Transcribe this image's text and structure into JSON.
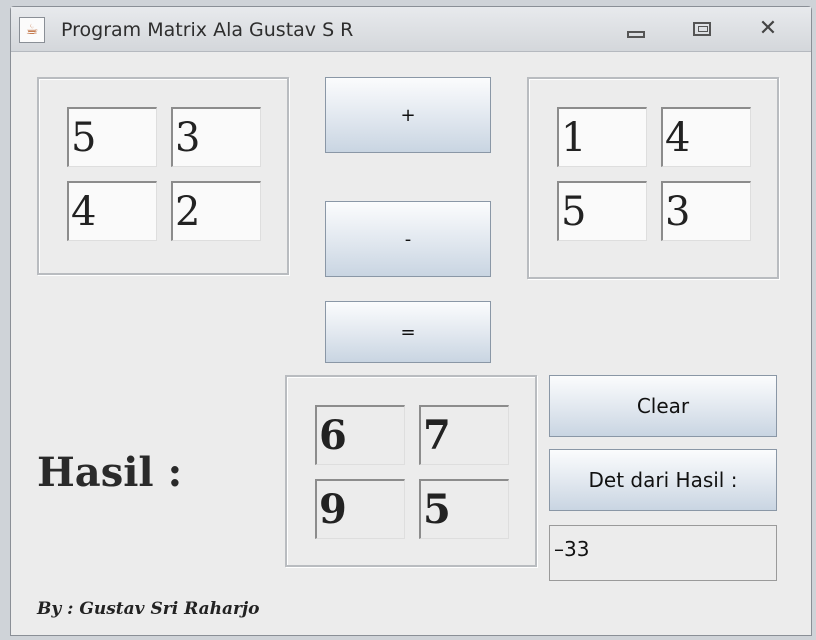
{
  "window": {
    "title": "Program Matrix Ala Gustav S R",
    "app_icon": "java-cup-icon",
    "controls": [
      "minimize-icon",
      "maximize-icon",
      "close-icon"
    ]
  },
  "matrix_a": [
    [
      "5",
      "3"
    ],
    [
      "4",
      "2"
    ]
  ],
  "matrix_b": [
    [
      "1",
      "4"
    ],
    [
      "5",
      "3"
    ]
  ],
  "operators": {
    "add_label": "+",
    "subtract_label": "-",
    "equals_label": "="
  },
  "result": {
    "label": "Hasil :",
    "matrix": [
      [
        "6",
        "7"
      ],
      [
        "9",
        "5"
      ]
    ]
  },
  "actions": {
    "clear_label": "Clear",
    "det_label": "Det dari Hasil :",
    "det_value": "–33"
  },
  "footer": "By : Gustav Sri Raharjo"
}
